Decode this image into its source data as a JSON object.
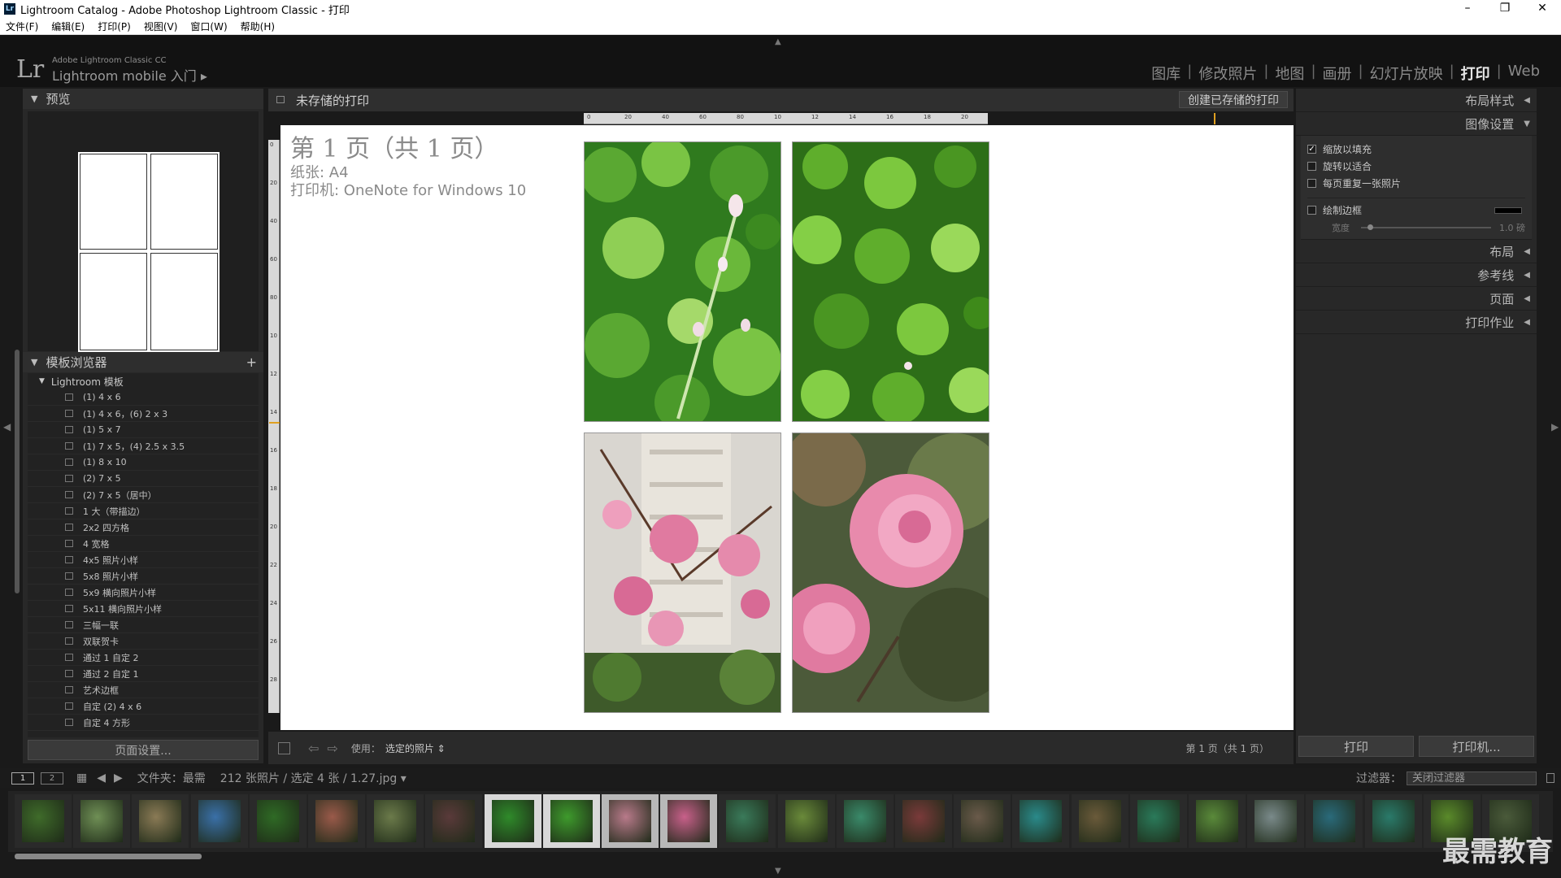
{
  "window": {
    "title": "Lightroom Catalog - Adobe Photoshop Lightroom Classic - 打印",
    "controls": [
      "–",
      "❐",
      "✕"
    ]
  },
  "menu": [
    "文件(F)",
    "编辑(E)",
    "打印(P)",
    "视图(V)",
    "窗口(W)",
    "帮助(H)"
  ],
  "identity": {
    "logo": "Lr",
    "product": "Adobe Lightroom Classic CC",
    "mobile": "Lightroom mobile 入门 ▸"
  },
  "modules": [
    {
      "label": "图库",
      "active": false
    },
    {
      "label": "修改照片",
      "active": false
    },
    {
      "label": "地图",
      "active": false
    },
    {
      "label": "画册",
      "active": false
    },
    {
      "label": "幻灯片放映",
      "active": false
    },
    {
      "label": "打印",
      "active": true
    },
    {
      "label": "Web",
      "active": false
    }
  ],
  "left_panel": {
    "preview_title": "预览",
    "template_browser_title": "模板浏览器",
    "folder": "Lightroom 模板",
    "templates": [
      "(1) 4 x 6",
      "(1) 4 x 6，(6) 2 x 3",
      "(1) 5 x 7",
      "(1) 7 x 5，(4) 2.5 x 3.5",
      "(1) 8 x 10",
      "(2) 7 x 5",
      "(2) 7 x 5（居中）",
      "1 大（带描边）",
      "2x2 四方格",
      "4 宽格",
      "4x5 照片小样",
      "5x8 照片小样",
      "5x9 横向照片小样",
      "5x11 横向照片小样",
      "三幅一联",
      "双联贺卡",
      "通过 1 自定 2",
      "通过 2 自定 1",
      "艺术边框",
      "自定 (2) 4 x 6",
      "自定 4 方形"
    ],
    "page_setup_btn": "页面设置..."
  },
  "center": {
    "header_title": "未存储的打印",
    "create_btn": "创建已存储的打印",
    "page_label": "第 1 页（共 1 页）",
    "paper": "纸张: A4",
    "printer": "打印机: OneNote for Windows 10",
    "ruler_top": [
      "0",
      "20",
      "40",
      "60",
      "80",
      "10",
      "12",
      "14",
      "16",
      "18",
      "20"
    ],
    "ruler_left": [
      "0",
      "20",
      "40",
      "60",
      "80",
      "10",
      "12",
      "14",
      "16",
      "18",
      "20",
      "22",
      "24",
      "26",
      "28"
    ],
    "toolbar": {
      "use_label": "使用：",
      "use_value": "选定的照片 ⇕",
      "page_status": "第 1 页（共 1 页）"
    }
  },
  "right_panel": {
    "sections": {
      "layout_style": "布局样式",
      "image_settings": "图像设置",
      "layout": "布局",
      "guides": "参考线",
      "page": "页面",
      "print_job": "打印作业"
    },
    "options": [
      {
        "label": "缩放以填充",
        "checked": true
      },
      {
        "label": "旋转以适合",
        "checked": false
      },
      {
        "label": "每页重复一张照片",
        "checked": false
      }
    ],
    "border": {
      "label": "绘制边框",
      "checked": false,
      "width_label": "宽度",
      "width_value": "1.0 磅"
    },
    "print_btn": "打印",
    "printer_btn": "打印机..."
  },
  "filmbar": {
    "source": "文件夹：最需",
    "counts": "212 张照片 / 选定 4 张 / 1.27.jpg ▾",
    "filter_label": "过滤器：",
    "filter_value": "关闭过滤器"
  },
  "filmstrip_colors": [
    "#3f6b2a",
    "#6f8f55",
    "#8a7a55",
    "#3a70a8",
    "#2f6a25",
    "#9a5a4a",
    "#6b7a4a",
    "#5a3a3a",
    "#2f8a2a",
    "#3e9a2c",
    "#b87a8a",
    "#c8608a",
    "#3a7a5a",
    "#6a8a3a",
    "#3a8a6a",
    "#7a3a3a",
    "#6a5a4a",
    "#2a8a8a",
    "#6a5a3a",
    "#2a7a5a",
    "#5a8a3a",
    "#7a8a8a",
    "#2a6a7a",
    "#2a7a6a",
    "#5a8a2a",
    "#4a5a3a"
  ],
  "watermark": "最需教育"
}
